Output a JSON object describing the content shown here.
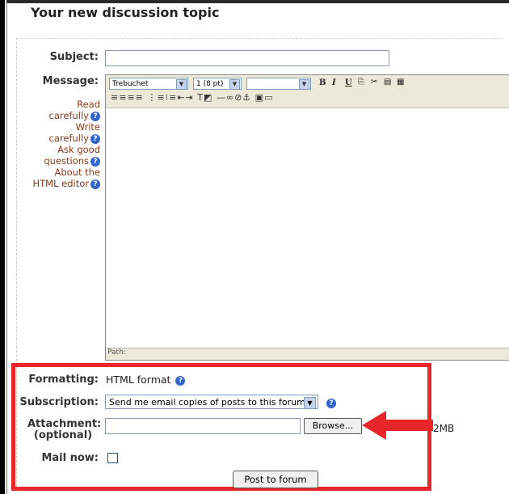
{
  "header": {
    "title": "Your new discussion topic"
  },
  "form": {
    "subject_label": "Subject:",
    "subject_value": "",
    "message_label": "Message:",
    "help_links": [
      {
        "text_a": "Read",
        "text_b": "carefully"
      },
      {
        "text_a": "Write",
        "text_b": "carefully"
      },
      {
        "text_a": "Ask good",
        "text_b": "questions"
      },
      {
        "text_a": "About the",
        "text_b": "HTML editor"
      }
    ],
    "help_icon": "question-circle-icon"
  },
  "editor": {
    "font_family": "Trebuchet",
    "font_size": "1 (8 pt)",
    "paragraph_style": "",
    "toolbar_buttons_row1": [
      "bold-icon",
      "italic-icon",
      "underline-icon",
      "copy-icon",
      "cut-icon",
      "paste-icon",
      "clean-word-icon"
    ],
    "toolbar_buttons_row2": [
      "align-left-icon",
      "align-center-icon",
      "align-right-icon",
      "justify-icon",
      "ordered-list-icon",
      "unordered-list-icon",
      "outdent-icon",
      "indent-icon",
      "text-color-icon",
      "bg-color-icon",
      "horizontal-rule-icon",
      "link-icon",
      "unlink-icon",
      "anchor-icon",
      "image-icon",
      "table-icon"
    ],
    "path_label": "Path:"
  },
  "options": {
    "formatting_label": "Formatting:",
    "formatting_value": "HTML format",
    "subscription_label": "Subscription:",
    "subscription_value": "Send me email copies of posts to this forum",
    "attachment_label": "Attachment:",
    "attachment_optional": "(optional)",
    "attachment_value": "",
    "browse_label": "Browse...",
    "max_size": "2MB",
    "mail_now_label": "Mail now:",
    "mail_now_checked": false,
    "submit_label": "Post to forum"
  },
  "colors": {
    "annotation_red": "#e8262a",
    "help_link": "#8b3a1a",
    "help_icon": "#3366cc"
  }
}
